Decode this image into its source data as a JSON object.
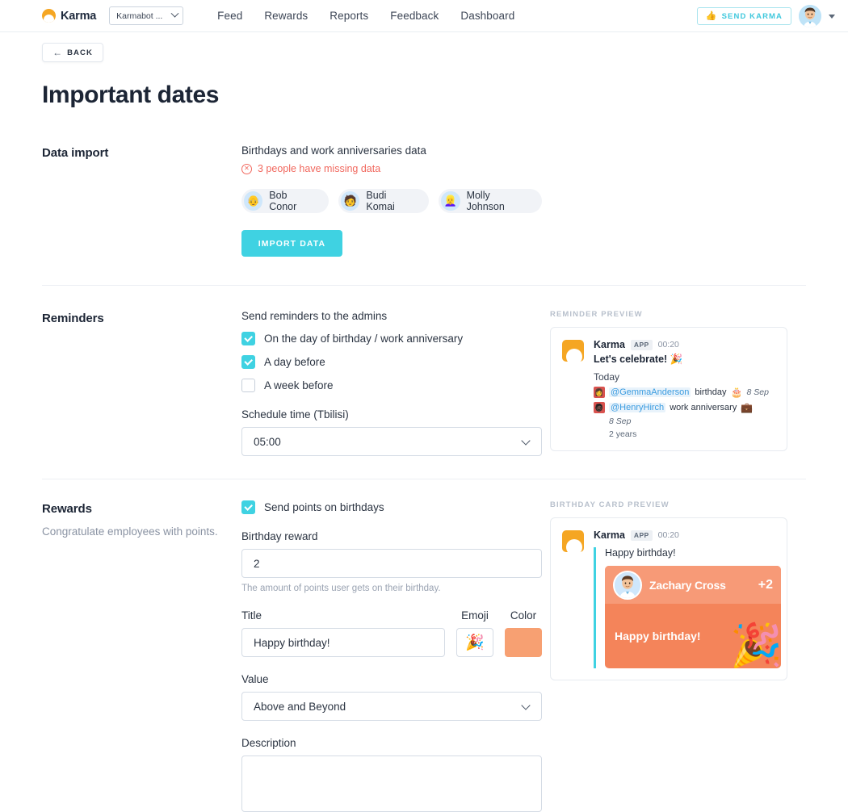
{
  "nav": {
    "brand": "Karma",
    "workspace": "Karmabot ...",
    "links": [
      "Feed",
      "Rewards",
      "Reports",
      "Feedback",
      "Dashboard"
    ],
    "send_karma_label": "SEND KARMA",
    "thumb_icon": "👍"
  },
  "back_button": {
    "label": "BACK",
    "arrow": "←"
  },
  "page_title": "Important dates",
  "data_import": {
    "heading": "Data import",
    "subtitle": "Birthdays and work anniversaries data",
    "warning": "3 people have missing data",
    "warning_icon": "✕",
    "people": [
      {
        "name": "Bob Conor",
        "face": "👴"
      },
      {
        "name": "Budi Komai",
        "face": "🧑"
      },
      {
        "name": "Molly Johnson",
        "face": "👱‍♀️"
      }
    ],
    "import_button": "IMPORT DATA"
  },
  "reminders": {
    "heading": "Reminders",
    "subtitle": "Send reminders to the admins",
    "checkboxes": [
      {
        "label": "On the day of birthday / work anniversary",
        "checked": true
      },
      {
        "label": "A day before",
        "checked": true
      },
      {
        "label": "A week before",
        "checked": false
      }
    ],
    "schedule_label": "Schedule time (Tbilisi)",
    "schedule_value": "05:00",
    "preview": {
      "title": "REMINDER PREVIEW",
      "app_name": "Karma",
      "app_tag": "APP",
      "time": "00:20",
      "headline": "Let's celebrate! 🎉",
      "day": "Today",
      "events": [
        {
          "mention": "@GemmaAnderson",
          "text": "birthday",
          "emoji": "🎂",
          "date": "8 Sep",
          "face": "👩"
        },
        {
          "mention": "@HenryHirch",
          "text": "work anniversary",
          "emoji": "💼",
          "date": "",
          "face": "🧔🏿"
        }
      ],
      "extra_lines": [
        "8 Sep",
        "2 years"
      ]
    }
  },
  "rewards": {
    "heading": "Rewards",
    "description": "Congratulate employees with points.",
    "send_points_label": "Send points on birthdays",
    "send_points_checked": true,
    "reward_label": "Birthday reward",
    "reward_value": "2",
    "reward_hint": "The amount of points user gets on their birthday.",
    "title_label": "Title",
    "title_value": "Happy birthday!",
    "emoji_label": "Emoji",
    "emoji_value": "🎉",
    "color_label": "Color",
    "color_value": "#f7a072",
    "value_label": "Value",
    "value_selected": "Above and Beyond",
    "description_label": "Description",
    "description_value": "",
    "preview": {
      "title": "BIRTHDAY CARD PREVIEW",
      "app_name": "Karma",
      "app_tag": "APP",
      "time": "00:20",
      "greeting": "Happy birthday!",
      "person": "Zachary Cross",
      "points": "+2",
      "card_message": "Happy birthday!",
      "card_emoji": "🎉"
    }
  },
  "colors": {
    "accent": "#3fd2e2",
    "brand": "#f5a623",
    "warning": "#f1685e",
    "card": "#f4845a"
  }
}
